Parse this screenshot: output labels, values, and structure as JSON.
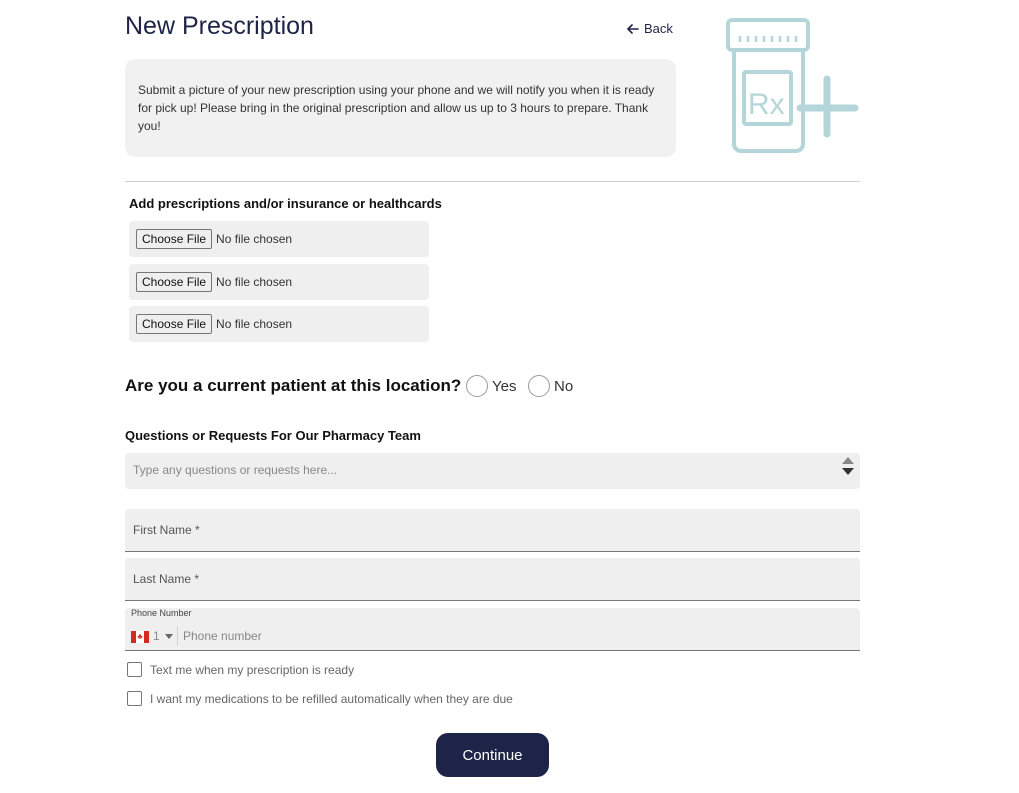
{
  "header": {
    "title": "New Prescription",
    "back_label": "Back"
  },
  "info": {
    "text": "Submit a picture of your new prescription using your phone and we will notify you when it is ready for pick up! Please bring in the original prescription and allow us up to 3 hours to prepare. Thank you!"
  },
  "illustration": {
    "icon": "rx-bottle-plus-icon",
    "rx_text": "Rx",
    "color": "#b5d6d9"
  },
  "upload": {
    "heading": "Add prescriptions and/or insurance or healthcards",
    "files": [
      {
        "button": "Choose File",
        "status": "No file chosen"
      },
      {
        "button": "Choose File",
        "status": "No file chosen"
      },
      {
        "button": "Choose File",
        "status": "No file chosen"
      }
    ]
  },
  "patient": {
    "question": "Are you a current patient at this location?",
    "yes": "Yes",
    "no": "No"
  },
  "questions": {
    "label": "Questions or Requests For Our Pharmacy Team",
    "placeholder": "Type any questions or requests here..."
  },
  "form": {
    "first_name": "First Name *",
    "last_name": "Last Name *",
    "phone_label": "Phone Number",
    "phone_country_code": "1",
    "phone_placeholder": "Phone number"
  },
  "checkboxes": {
    "text_me": "Text me when my prescription is ready",
    "auto_refill": "I want my medications to be refilled automatically when they are due"
  },
  "actions": {
    "continue": "Continue"
  },
  "colors": {
    "primary": "#1d2447",
    "field_bg": "#efefef",
    "accent": "#b5d6d9"
  }
}
